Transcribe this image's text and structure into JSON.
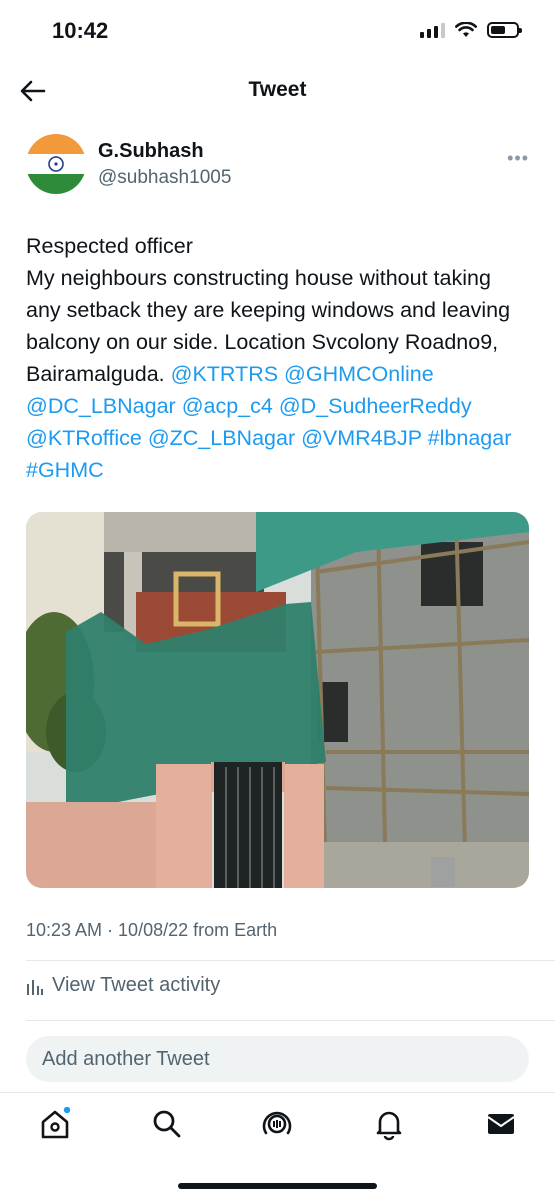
{
  "status_bar": {
    "time": "10:42"
  },
  "header": {
    "title": "Tweet",
    "back_icon": "arrow-left-icon"
  },
  "tweet": {
    "author": {
      "name": "G.Subhash",
      "handle": "@subhash1005"
    },
    "text_lines": [
      "Respected officer",
      "My neighbours constructing house without taking any setback they are keeping windows and leaving balcony on our side. Location Svcolony Roadno9, Bairamalguda. "
    ],
    "links": {
      "m1": "@KTRTRS",
      "m2": "@GHMCOnline",
      "m3": "@DC_LBNagar",
      "m4": "@acp_c4",
      "m5": "@D_SudheerReddy",
      "m6": "@KTRoffice",
      "m7": "@ZC_LBNagar",
      "m8": "@VMR4BJP",
      "h1": "#lbnagar",
      "h2": "#GHMC"
    },
    "timestamp": "10:23 AM · 10/08/22 from Earth"
  },
  "activity": {
    "label": "View Tweet activity",
    "icon": "bar-chart-icon"
  },
  "reply": {
    "placeholder": "Add another Tweet"
  },
  "tabbar": {
    "icons": [
      "home-icon",
      "search-icon",
      "spaces-icon",
      "bell-icon",
      "mail-icon"
    ]
  },
  "colors": {
    "link": "#1d9bf0",
    "text": "#0f1419",
    "secondary": "#536471"
  }
}
